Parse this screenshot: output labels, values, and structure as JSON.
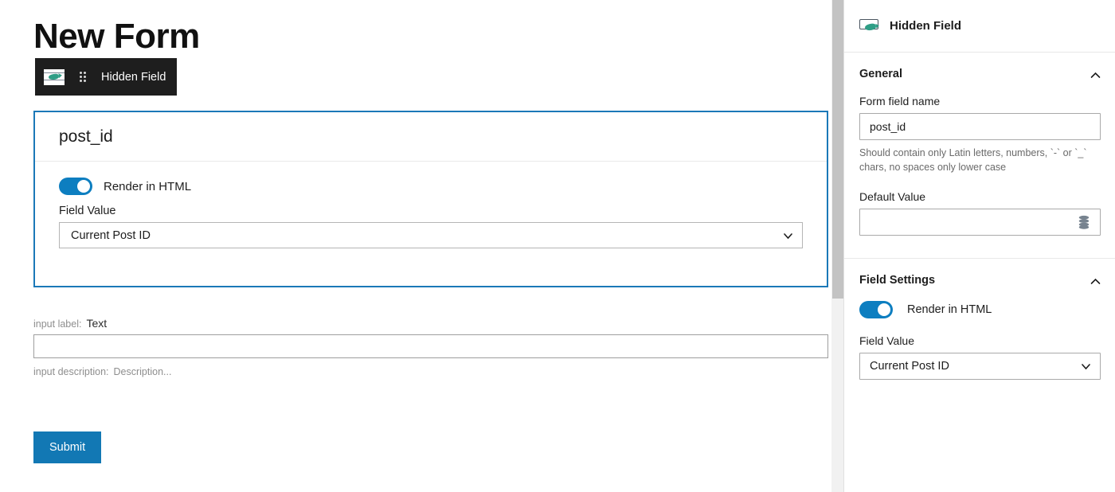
{
  "editor": {
    "page_title": "New Form",
    "toolbar": {
      "block_icon": "hidden-field-icon",
      "drag_handle_icon": "drag-handle-icon",
      "block_name": "Hidden Field"
    },
    "selected_block": {
      "heading": "post_id",
      "render_toggle": {
        "label": "Render in HTML",
        "state": "on"
      },
      "field_value_label": "Field Value",
      "field_value_selected": "Current Post ID",
      "chevron_icon": "chevron-down-icon"
    },
    "preview": {
      "label_prefix": "input label:",
      "label_value": "Text",
      "input_value": "",
      "description_prefix": "input description:",
      "description_value": "Description...",
      "submit_label": "Submit"
    }
  },
  "sidebar": {
    "header": {
      "icon": "hidden-field-icon",
      "title": "Hidden Field"
    },
    "sections": [
      {
        "title": "General",
        "collapse_icon": "chevron-up-icon",
        "form_field_name_label": "Form field name",
        "form_field_name_value": "post_id",
        "form_field_name_help": "Should contain only Latin letters, numbers, `-` or `_` chars, no spaces only lower case",
        "default_value_label": "Default Value",
        "default_value_value": "",
        "default_value_icon": "database-icon"
      },
      {
        "title": "Field Settings",
        "collapse_icon": "chevron-up-icon",
        "render_toggle_label": "Render in HTML",
        "render_toggle_state": "on",
        "field_value_label": "Field Value",
        "field_value_selected": "Current Post ID",
        "chevron_icon": "chevron-down-icon"
      }
    ]
  },
  "scrollbar": {
    "orientation": "vertical",
    "thumb_position": "top"
  },
  "colors": {
    "accent_blue": "#1278b4",
    "toggle_blue": "#0d7ec0",
    "block_border": "#1b78b8",
    "toolbar_dark": "#1e1e1e"
  }
}
